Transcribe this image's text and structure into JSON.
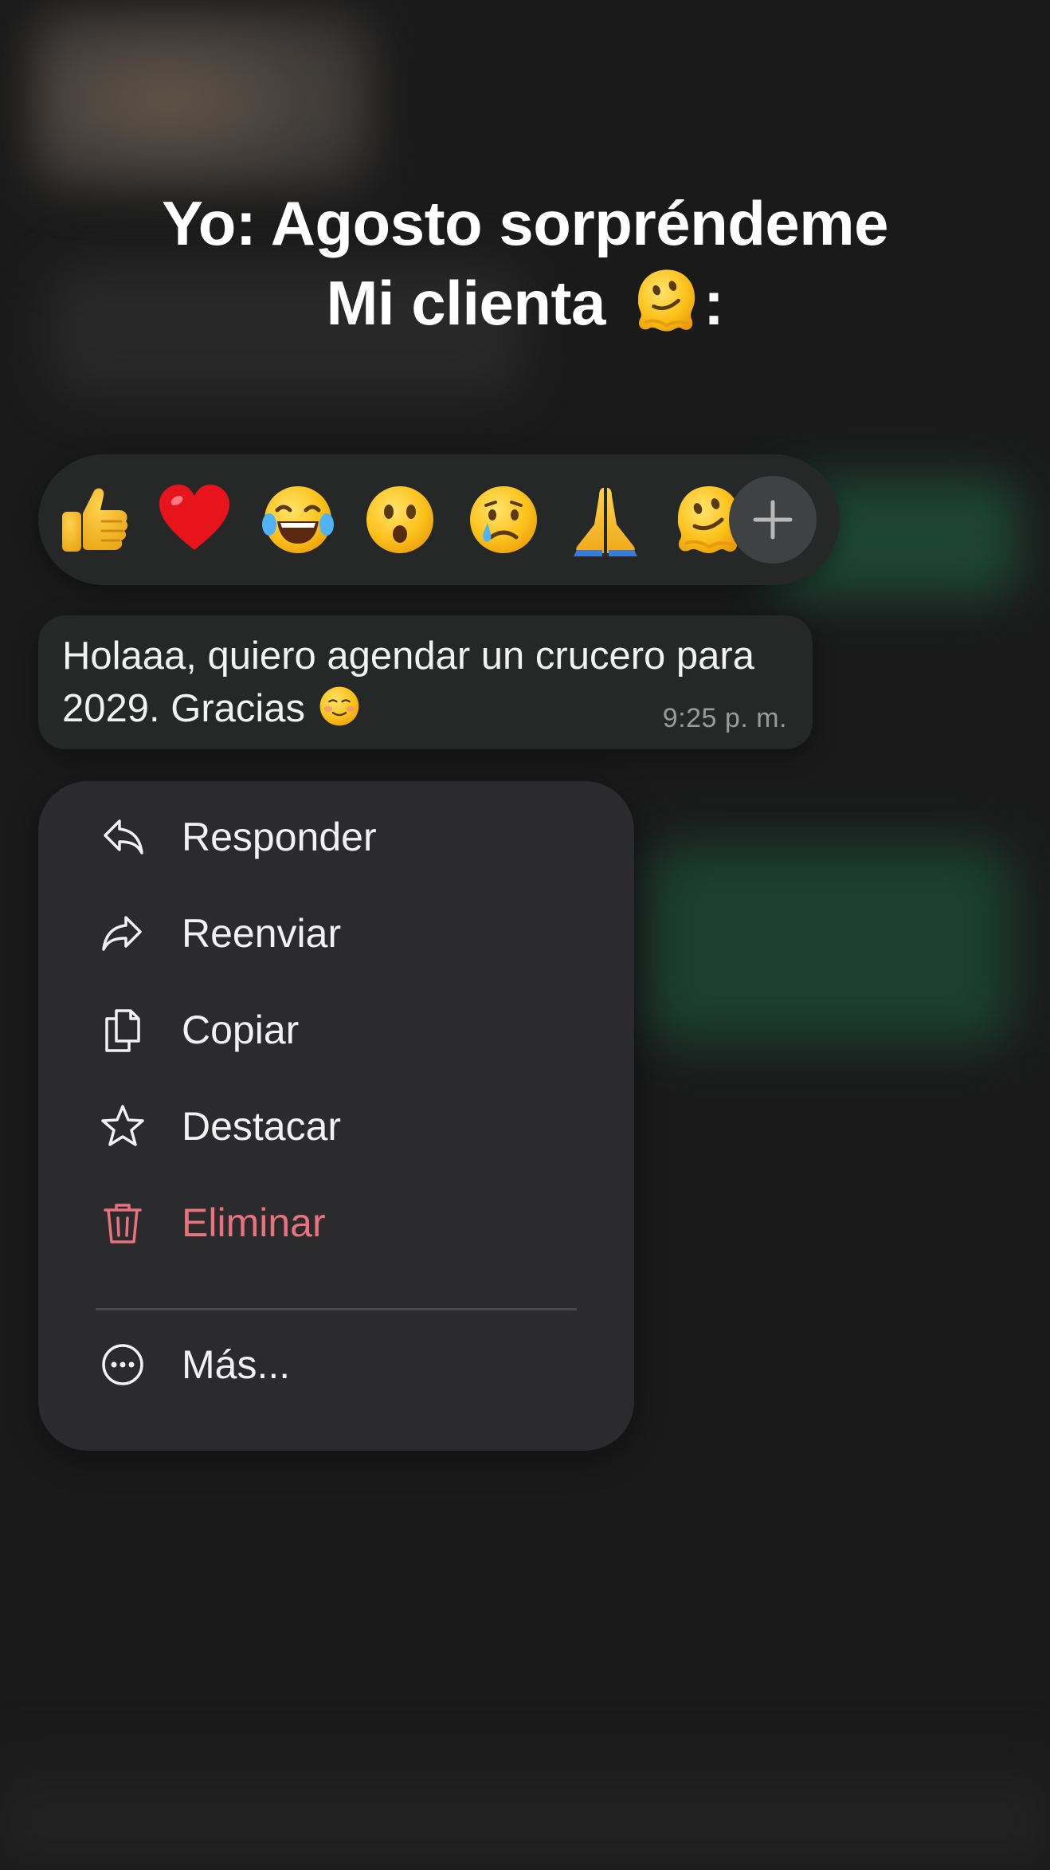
{
  "caption": {
    "line1": "Yo: Agosto sorpréndeme",
    "line2": "Mi clienta",
    "line2_suffix": ":",
    "line2_emoji": "melting-face"
  },
  "reaction_bar": {
    "reactions": [
      "thumbs-up",
      "red-heart",
      "face-with-tears-of-joy",
      "face-with-open-mouth",
      "crying-face",
      "folded-hands",
      "melting-face"
    ],
    "add_icon": "plus-icon"
  },
  "message": {
    "text": "Holaaa, quiero agendar un crucero para 2029. Gracias",
    "text_emoji": "smiling-face",
    "time": "9:25 p. m."
  },
  "menu": {
    "items": [
      {
        "label": "Responder",
        "icon": "reply-icon"
      },
      {
        "label": "Reenviar",
        "icon": "forward-icon"
      },
      {
        "label": "Copiar",
        "icon": "copy-icon"
      },
      {
        "label": "Destacar",
        "icon": "star-icon"
      },
      {
        "label": "Eliminar",
        "icon": "trash-icon"
      },
      {
        "label": "Más...",
        "icon": "more-icon"
      }
    ]
  },
  "colors": {
    "background": "#1a1a1a",
    "surface": "#262828",
    "menu_surface": "#2b2b2d",
    "danger": "#e8727e",
    "timestamp": "#9a9a9a"
  }
}
